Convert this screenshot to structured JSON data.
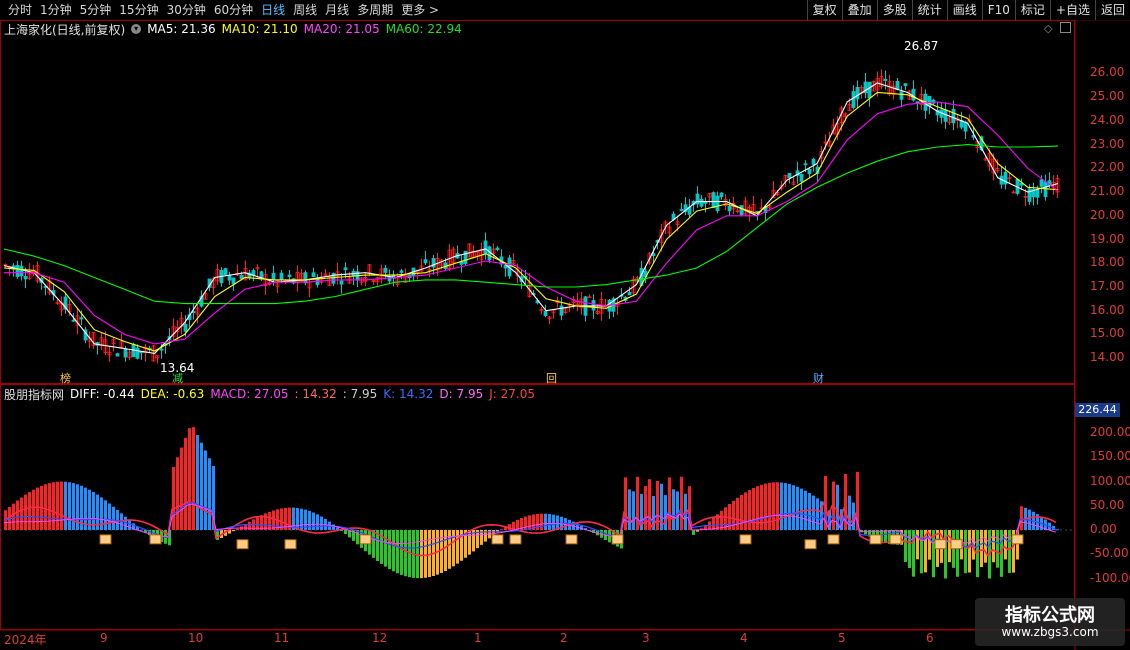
{
  "toolbar": {
    "periods": [
      "分时",
      "1分钟",
      "5分钟",
      "15分钟",
      "30分钟",
      "60分钟",
      "日线",
      "周线",
      "月线",
      "多周期",
      "更多 >"
    ],
    "active_period": "日线",
    "right_buttons": [
      "复权",
      "叠加",
      "多股",
      "统计",
      "画线",
      "F10",
      "标记",
      "+自选",
      "返回"
    ]
  },
  "main_chart": {
    "stock_title": "上海家化(日线,前复权)",
    "ma5": "MA5: 21.36",
    "ma10": "MA10: 21.10",
    "ma20": "MA20: 21.05",
    "ma60": "MA60: 22.94",
    "high_marker": "26.87",
    "low_marker": "13.64",
    "y_ticks": [
      "26.00",
      "25.00",
      "24.00",
      "23.00",
      "22.00",
      "21.00",
      "20.00",
      "19.00",
      "18.00",
      "17.00",
      "16.00",
      "15.00",
      "14.00"
    ],
    "event_tags": [
      "榜",
      "减",
      "回",
      "财"
    ]
  },
  "indicator_panel": {
    "name": "股朋指标网",
    "diff": "DIFF: -0.44",
    "dea": "DEA: -0.63",
    "macd": "MACD: 27.05",
    "v1": ": 14.32",
    "v2": ": 7.95",
    "k": "K: 14.32",
    "d": "D: 7.95",
    "j": "J: 27.05",
    "current_value": "226.44",
    "y_ticks": [
      "200.00",
      "150.00",
      "100.00",
      "50.00",
      "0.00",
      "-50.00",
      "-100.00"
    ]
  },
  "date_axis": [
    "2024年",
    "9",
    "10",
    "11",
    "12",
    "1",
    "2",
    "3",
    "4",
    "5",
    "6"
  ],
  "watermark": {
    "title": "指标公式网",
    "url": "www.zbgs3.com"
  },
  "colors": {
    "up": "#ff2020",
    "down": "#00c8c8",
    "ma5": "#ffffff",
    "ma10": "#ffff00",
    "ma20": "#ff00ff",
    "ma60": "#00ff00",
    "diff": "#ff2a4a",
    "dea": "#3050ff",
    "macd_pos_red": "#ff2020",
    "macd_pos_blue": "#1e90ff",
    "macd_neg_green": "#22cc22",
    "macd_neg_orange": "#ffb020"
  },
  "chart_data": {
    "type": "line",
    "title": "上海家化(日线,前复权)",
    "ylim": [
      13.5,
      27.2
    ],
    "series": [
      {
        "name": "MA5",
        "values": [
          17.9,
          17.6,
          16.2,
          14.6,
          14.4,
          14.2,
          15.5,
          17.4,
          17.6,
          17.2,
          17.3,
          17.5,
          17.6,
          17.4,
          17.8,
          18.3,
          18.6,
          17.6,
          16.0,
          16.2,
          16.2,
          17.1,
          19.6,
          20.6,
          20.6,
          20.0,
          21.5,
          22.2,
          24.8,
          25.6,
          25.2,
          24.4,
          23.9,
          21.6,
          21.0,
          21.36
        ]
      },
      {
        "name": "MA10",
        "values": [
          17.8,
          17.7,
          16.8,
          15.2,
          14.7,
          14.3,
          15.0,
          16.6,
          17.4,
          17.3,
          17.3,
          17.4,
          17.5,
          17.5,
          17.6,
          18.0,
          18.4,
          17.8,
          16.5,
          16.2,
          16.1,
          16.7,
          19.0,
          20.2,
          20.5,
          20.1,
          21.0,
          21.8,
          24.2,
          25.2,
          25.1,
          24.6,
          24.1,
          22.2,
          21.2,
          21.1
        ]
      },
      {
        "name": "MA20",
        "values": [
          17.6,
          17.6,
          17.2,
          15.8,
          15.0,
          14.6,
          14.8,
          15.9,
          16.9,
          17.2,
          17.2,
          17.3,
          17.3,
          17.4,
          17.5,
          17.8,
          18.1,
          17.9,
          17.0,
          16.4,
          16.2,
          16.4,
          18.0,
          19.4,
          20.0,
          20.0,
          20.6,
          21.4,
          23.2,
          24.3,
          24.7,
          24.8,
          24.6,
          23.4,
          22.0,
          21.05
        ]
      },
      {
        "name": "MA60",
        "values": [
          18.6,
          18.3,
          17.9,
          17.4,
          16.9,
          16.4,
          16.3,
          16.3,
          16.3,
          16.3,
          16.4,
          16.6,
          16.9,
          17.2,
          17.3,
          17.3,
          17.2,
          17.1,
          17.0,
          17.0,
          17.1,
          17.3,
          17.5,
          17.8,
          18.5,
          19.5,
          20.5,
          21.2,
          21.8,
          22.3,
          22.7,
          22.9,
          23.0,
          22.9,
          22.9,
          22.94
        ]
      }
    ]
  }
}
